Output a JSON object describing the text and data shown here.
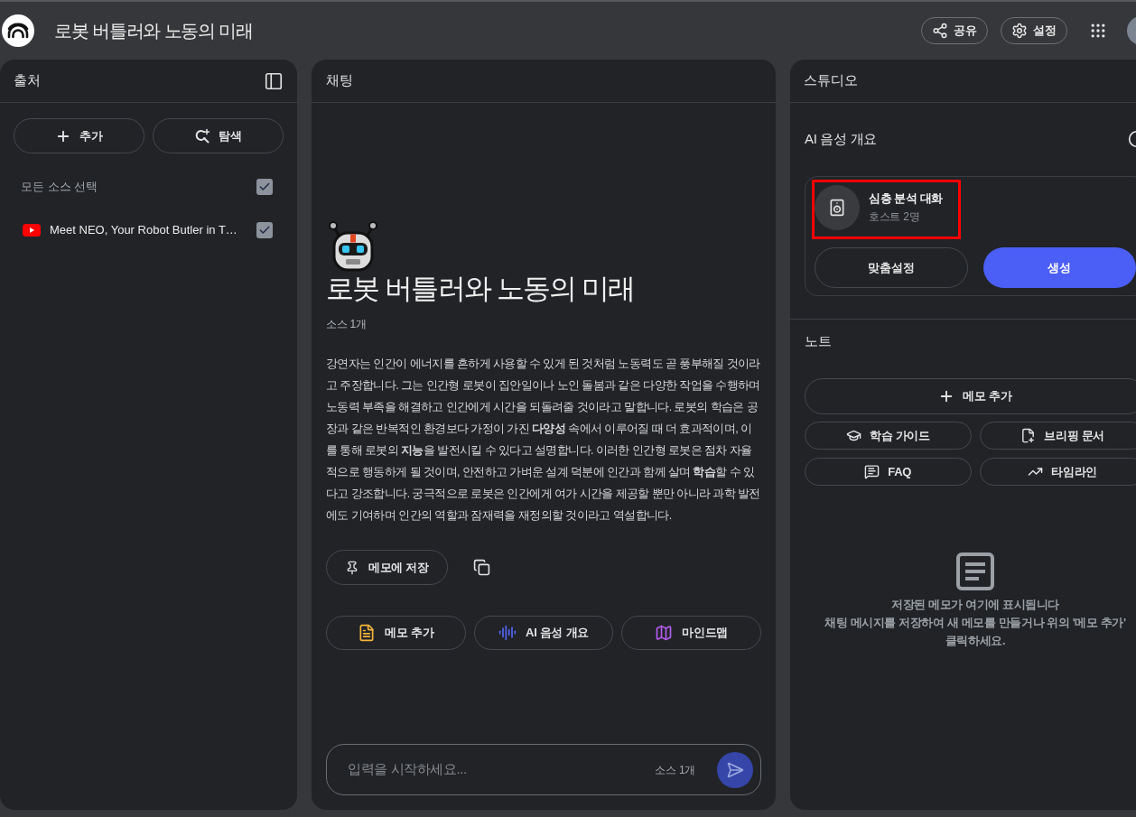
{
  "header": {
    "title": "로봇 버틀러와 노동의 미래",
    "buttons": [
      {
        "kind": "share",
        "label": "공유"
      },
      {
        "kind": "settings",
        "label": "설정"
      }
    ]
  },
  "sources": {
    "title": "출처",
    "actions": [
      {
        "kind": "add",
        "label": "추가"
      },
      {
        "kind": "discover",
        "label": "탐색"
      }
    ],
    "select_all": {
      "label": "모든 소스 선택",
      "checked": true
    },
    "items": [
      {
        "kind": "youtube",
        "title": "Meet NEO, Your Robot Butler in T…",
        "checked": true
      }
    ]
  },
  "chat": {
    "title": "채팅",
    "heading": "로봇 버틀러와 노동의 미래",
    "source_count": "소스 1개",
    "summary": "강연자는 인간이 에너지를 흔하게 사용할 수 있게 된 것처럼 노동력도 곧 풍부해질 것이라고 주장합니다. 그는 인간형 로봇이 집안일이나 노인 돌봄과 같은 다양한 작업을 수행하며 노동력 부족을 해결하고 인간에게 시간을 되돌려줄 것이라고 말합니다. 로봇의 학습은 공장과 같은 반복적인 환경보다 가정이 가진 **다양성** 속에서 이루어질 때 더 효과적이며, 이를 통해 로봇의 **지능**을 발전시킬 수 있다고 설명합니다. 이러한 인간형 로봇은 점차 자율적으로 행동하게 될 것이며, 안전하고 가벼운 설계 덕분에 인간과 함께 살며 **학습**할 수 있다고 강조합니다. 궁극적으로 로봇은 인간에게 여가 시간을 제공할 뿐만 아니라 과학 발전에도 기여하며 인간의 역할과 잠재력을 재정의할 것이라고 역설합니다.",
    "save_button": "메모에 저장",
    "suggestions": [
      {
        "kind": "note",
        "label": "메모 추가"
      },
      {
        "kind": "audio",
        "label": "AI 음성 개요"
      },
      {
        "kind": "mindmap",
        "label": "마인드맵"
      }
    ],
    "input": {
      "placeholder": "입력을 시작하세요...",
      "source_count": "소스 1개"
    }
  },
  "studio": {
    "title": "스튜디오",
    "audio_overview": {
      "title": "AI 음성 개요",
      "format": {
        "title": "심층 분석 대화",
        "subtitle": "호스트 2명",
        "highlighted": true
      },
      "buttons": [
        {
          "kind": "customize",
          "label": "맞춤설정"
        },
        {
          "kind": "generate",
          "label": "생성"
        }
      ]
    },
    "notes": {
      "title": "노트",
      "add_button": "메모 추가",
      "tools": [
        {
          "kind": "study_guide",
          "label": "학습 가이드"
        },
        {
          "kind": "briefing",
          "label": "브리핑 문서"
        },
        {
          "kind": "faq",
          "label": "FAQ"
        },
        {
          "kind": "timeline",
          "label": "타임라인"
        }
      ],
      "empty": {
        "title": "저장된 메모가 여기에 표시됩니다",
        "description": "채팅 메시지를 저장하여 새 메모를 만들거나 위의 '메모 추가'\n클릭하세요."
      }
    }
  }
}
